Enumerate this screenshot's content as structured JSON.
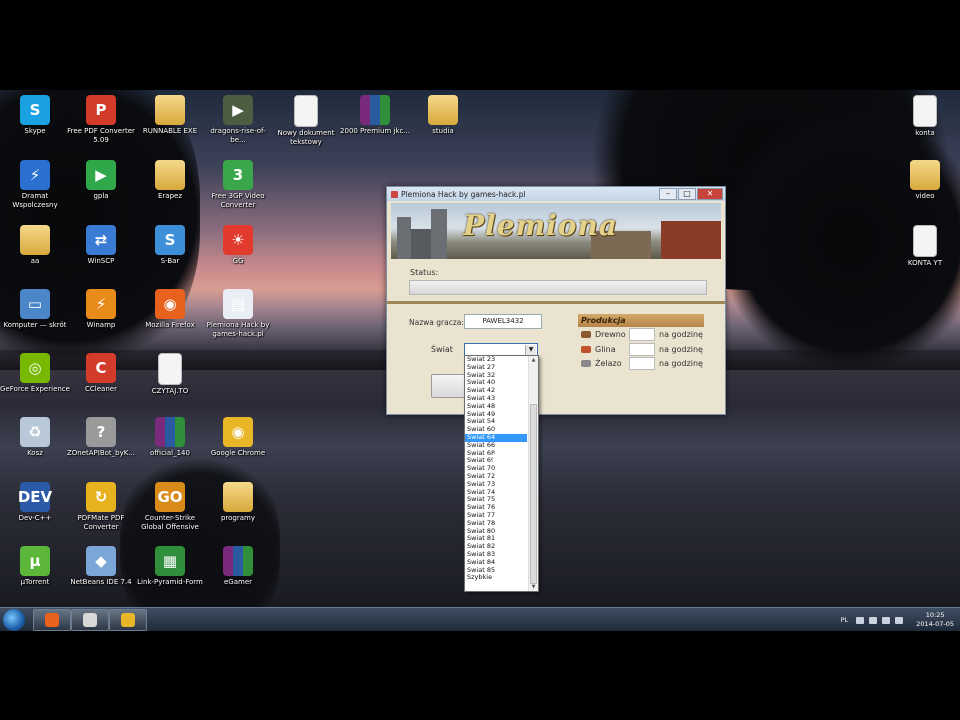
{
  "desktop": {
    "icons": [
      {
        "id": "skype",
        "label": "Skype",
        "icon": "skype-icon",
        "color": "#1aa1e1",
        "glyph": "S"
      },
      {
        "id": "free-pdf",
        "label": "Free PDF Converter 5.09",
        "icon": "pdf-icon",
        "color": "#d23a2a",
        "glyph": "P"
      },
      {
        "id": "runnable",
        "label": "RUNNABLE EXE",
        "icon": "folder-icon",
        "color": "#e8c25c",
        "glyph": ""
      },
      {
        "id": "dragons",
        "label": "dragons-rise-of-be...",
        "icon": "video-icon",
        "color": "#4b5e42",
        "glyph": "▶"
      },
      {
        "id": "nowy-doc",
        "label": "Nowy dokument tekstowy",
        "icon": "text-document-icon",
        "color": "#f4f4f4",
        "glyph": ""
      },
      {
        "id": "premium",
        "label": "2000 Premium jkc...",
        "icon": "rar-archive-icon",
        "color": "#7a2a7a",
        "glyph": ""
      },
      {
        "id": "studia",
        "label": "studia",
        "icon": "folder-icon",
        "color": "#e8c25c",
        "glyph": ""
      },
      {
        "id": "konta",
        "label": "konta",
        "icon": "text-document-icon",
        "color": "#f4f4f4",
        "glyph": ""
      },
      {
        "id": "dramat",
        "label": "Dramat Wspolczesny",
        "icon": "lightning-icon",
        "color": "#2b6fd0",
        "glyph": "⚡"
      },
      {
        "id": "gpla",
        "label": "gpla",
        "icon": "play-icon",
        "color": "#2fa84a",
        "glyph": "▶"
      },
      {
        "id": "erapez",
        "label": "Erapez",
        "icon": "folder-icon",
        "color": "#e8c25c",
        "glyph": ""
      },
      {
        "id": "free3gp",
        "label": "Free 3GP Video Converter",
        "icon": "video-converter-icon",
        "color": "#3aa84a",
        "glyph": "3"
      },
      {
        "id": "video",
        "label": "video",
        "icon": "folder-icon",
        "color": "#e8c25c",
        "glyph": ""
      },
      {
        "id": "aa",
        "label": "aa",
        "icon": "folder-icon",
        "color": "#e8c25c",
        "glyph": ""
      },
      {
        "id": "winscp",
        "label": "WinSCP",
        "icon": "winscp-icon",
        "color": "#3a7bd5",
        "glyph": "⇄"
      },
      {
        "id": "sbar",
        "label": "S-Bar",
        "icon": "sbar-icon",
        "color": "#3d8fd8",
        "glyph": "S"
      },
      {
        "id": "gg",
        "label": "GG",
        "icon": "sun-icon",
        "color": "#e23b2e",
        "glyph": "☀"
      },
      {
        "id": "konta-yt",
        "label": "KONTA YT",
        "icon": "text-document-icon",
        "color": "#f4f4f4",
        "glyph": ""
      },
      {
        "id": "komputer",
        "label": "Komputer — skrót",
        "icon": "computer-icon",
        "color": "#4a86c8",
        "glyph": "▭"
      },
      {
        "id": "winamp",
        "label": "Winamp",
        "icon": "winamp-icon",
        "color": "#e98b1a",
        "glyph": "⚡"
      },
      {
        "id": "firefox",
        "label": "Mozilla Firefox",
        "icon": "firefox-icon",
        "color": "#e8621e",
        "glyph": "◉"
      },
      {
        "id": "plemiona-hack",
        "label": "Plemiona Hack by games-hack.pl",
        "icon": "window-icon",
        "color": "#e9eef5",
        "glyph": "▤"
      },
      {
        "id": "geforce",
        "label": "GeForce Experience",
        "icon": "nvidia-icon",
        "color": "#76b900",
        "glyph": "◎"
      },
      {
        "id": "ccleaner",
        "label": "CCleaner",
        "icon": "ccleaner-icon",
        "color": "#d33b2b",
        "glyph": "C"
      },
      {
        "id": "czytaj",
        "label": "CZYTAJ.TO",
        "icon": "text-document-icon",
        "color": "#f4f4f4",
        "glyph": ""
      },
      {
        "id": "kosz",
        "label": "Kosz",
        "icon": "recycle-bin-icon",
        "color": "#b9c8d8",
        "glyph": "♻"
      },
      {
        "id": "zonet",
        "label": "ZOnetAPIBot_byK...",
        "icon": "unknown-file-icon",
        "color": "#9a9a9a",
        "glyph": "?"
      },
      {
        "id": "official",
        "label": "official_140",
        "icon": "rar-archive-icon",
        "color": "#7a2a7a",
        "glyph": ""
      },
      {
        "id": "chrome",
        "label": "Google Chrome",
        "icon": "chrome-icon",
        "color": "#e9b628",
        "glyph": "◉"
      },
      {
        "id": "devcpp",
        "label": "Dev-C++",
        "icon": "devcpp-icon",
        "color": "#2a5aa8",
        "glyph": "DEV"
      },
      {
        "id": "pdfmate",
        "label": "PDFMate PDF Converter",
        "icon": "pdfmate-icon",
        "color": "#e6b21e",
        "glyph": "↻"
      },
      {
        "id": "cs",
        "label": "Counter-Strike Global Offensive",
        "icon": "csgo-icon",
        "color": "#d98b1a",
        "glyph": "GO"
      },
      {
        "id": "programy",
        "label": "programy",
        "icon": "folder-icon",
        "color": "#e8c25c",
        "glyph": ""
      },
      {
        "id": "utorrent",
        "label": "µTorrent",
        "icon": "utorrent-icon",
        "color": "#5bb63a",
        "glyph": "µ"
      },
      {
        "id": "netbeans",
        "label": "NetBeans IDE 7.4",
        "icon": "netbeans-icon",
        "color": "#7aa6d8",
        "glyph": "◆"
      },
      {
        "id": "linkpyramid",
        "label": "Link-Pyramid-Form",
        "icon": "spreadsheet-icon",
        "color": "#2f8f3a",
        "glyph": "▦"
      },
      {
        "id": "egamer",
        "label": "eGamer",
        "icon": "rar-archive-icon",
        "color": "#7a2a7a",
        "glyph": ""
      }
    ]
  },
  "window": {
    "title": "Plemiona Hack by games-hack.pl",
    "controls": {
      "minimize": "–",
      "maximize": "□",
      "close": "✕"
    },
    "banner_logo": "Plemiona",
    "status_label": "Status:",
    "nick_label": "Nazwa gracza:",
    "nick_value": "PAWEL3432",
    "world_label": "Świat",
    "production": {
      "header": "Produkcja",
      "rows": [
        {
          "name": "Drewno",
          "unit": "na godzinę",
          "color": "#8b5a2b"
        },
        {
          "name": "Glina",
          "unit": "na godzinę",
          "color": "#c0502a"
        },
        {
          "name": "Żelazo",
          "unit": "na godzinę",
          "color": "#8a8a8a"
        }
      ]
    }
  },
  "dropdown": {
    "selected": "Świat 64",
    "items": [
      "Świat 23",
      "Świat 27",
      "Świat 32",
      "Świat 40",
      "Świat 42",
      "Świat 43",
      "Świat 48",
      "Świat 49",
      "Świat 54",
      "Świat 60",
      "Świat 64",
      "Świat 66",
      "Świat 68",
      "Świat 69",
      "Świat 70",
      "Świat 72",
      "Świat 73",
      "Świat 74",
      "Świat 75",
      "Świat 76",
      "Świat 77",
      "Świat 78",
      "Świat 80",
      "Świat 81",
      "Świat 82",
      "Świat 83",
      "Świat 84",
      "Świat 85",
      "Szybkie"
    ]
  },
  "taskbar": {
    "buttons": [
      {
        "id": "firefox",
        "icon": "firefox-icon",
        "color": "#e8621e"
      },
      {
        "id": "recorder",
        "icon": "screen-recorder-icon",
        "color": "#d8d8d8"
      },
      {
        "id": "plemiona",
        "icon": "window-icon",
        "color": "#e9b628"
      }
    ],
    "tray": {
      "lang": "PL",
      "time": "10:25",
      "date": "2014-07-05"
    }
  }
}
